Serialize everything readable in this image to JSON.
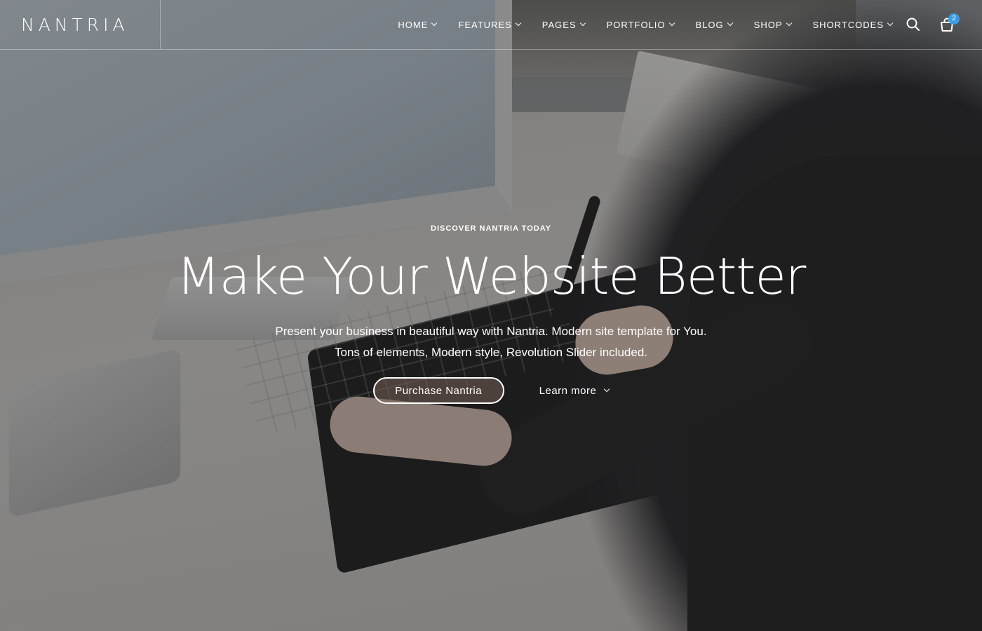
{
  "brand": {
    "logo": "NANTRIA"
  },
  "nav": {
    "items": [
      {
        "label": "HOME"
      },
      {
        "label": "FEATURES"
      },
      {
        "label": "PAGES"
      },
      {
        "label": "PORTFOLIO"
      },
      {
        "label": "BLOG"
      },
      {
        "label": "SHOP"
      },
      {
        "label": "SHORTCODES"
      }
    ],
    "search_icon": "search-icon",
    "cart_icon": "shopping-bag-icon",
    "cart_count": "2"
  },
  "hero": {
    "eyebrow": "DISCOVER NANTRIA TODAY",
    "headline": "Make Your Website Better",
    "subline_1": "Present your business in beautiful way with Nantria. Modern site template for You.",
    "subline_2": "Tons of elements, Modern style, Revolution Slider included.",
    "primary_button": "Purchase Nantria",
    "secondary_button": "Learn more"
  },
  "colors": {
    "badge": "#3a9be6",
    "overlay": "#1e1e20",
    "text": "#ffffff"
  }
}
